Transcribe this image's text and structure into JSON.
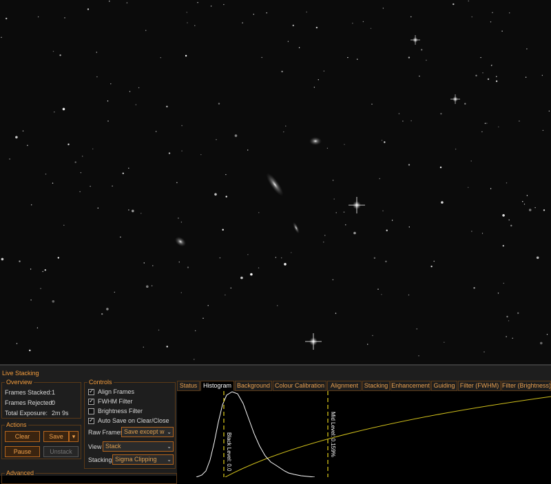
{
  "panel": {
    "title": "Live Stacking"
  },
  "overview": {
    "legend": "Overview",
    "frames_stacked_label": "Frames Stacked:",
    "frames_stacked_value": "1",
    "frames_rejected_label": "Frames Rejected:",
    "frames_rejected_value": "0",
    "total_exposure_label": "Total Exposure:",
    "total_exposure_value": "2m 9s"
  },
  "actions": {
    "legend": "Actions",
    "clear_label": "Clear",
    "save_label": "Save",
    "save_dropdown_glyph": "▾",
    "pause_label": "Pause",
    "unstack_label": "Unstack"
  },
  "advanced": {
    "legend": "Advanced"
  },
  "controls": {
    "legend": "Controls",
    "align_frames": {
      "label": "Align Frames",
      "checked": true
    },
    "fwhm_filter": {
      "label": "FWHM Filter",
      "checked": true
    },
    "brightness_filter": {
      "label": "Brightness Filter",
      "checked": false
    },
    "auto_save": {
      "label": "Auto Save on Clear/Close",
      "checked": true
    },
    "raw_frames_label": "Raw Frames",
    "raw_frames_value": "Save except w",
    "view_label": "View",
    "view_value": "Stack",
    "stacking_label": "Stacking",
    "stacking_value": "Sigma Clipping",
    "dropdown_glyph": "⌄"
  },
  "tabs": [
    {
      "label": "Status",
      "active": false
    },
    {
      "label": "Histogram",
      "active": true
    },
    {
      "label": "Background",
      "active": false
    },
    {
      "label": "Colour Calibration",
      "active": false
    },
    {
      "label": "Alignment",
      "active": false
    },
    {
      "label": "Stacking",
      "active": false
    },
    {
      "label": "Enhancement",
      "active": false
    },
    {
      "label": "Guiding",
      "active": false
    },
    {
      "label": "Filter (FWHM)",
      "active": false
    },
    {
      "label": "Filter (Brightness)",
      "active": false
    }
  ],
  "histogram": {
    "black_level_label": "Black Level: 0.0",
    "mid_level_label": "Mid Level: 0.159%"
  },
  "colors": {
    "accent": "#f39c3c",
    "button_border": "#b5651d",
    "curve": "#d4c31c",
    "marker": "#e6d21a",
    "histogram_line": "#ffffff"
  }
}
